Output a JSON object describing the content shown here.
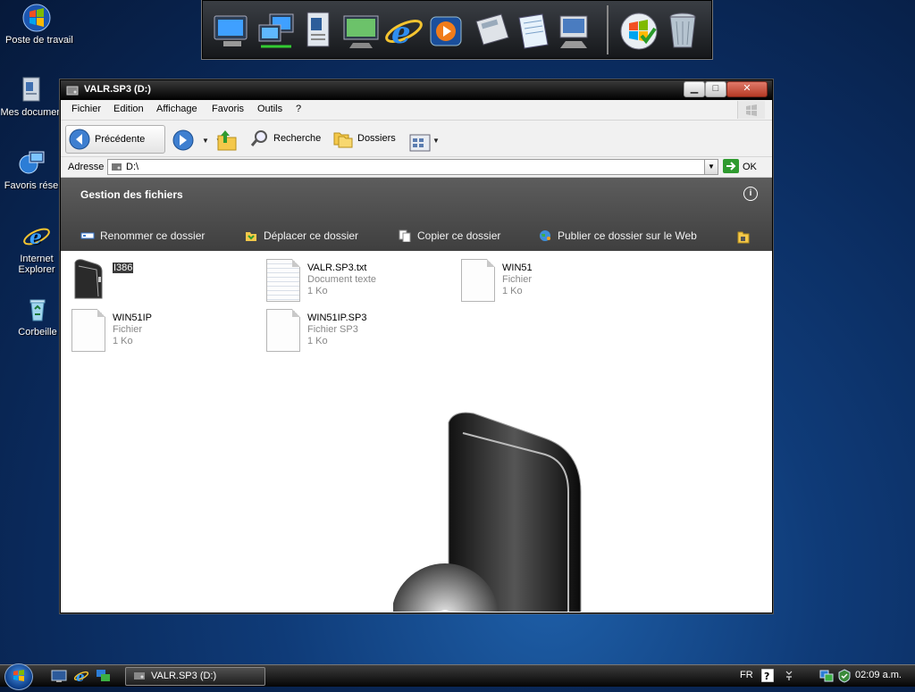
{
  "desktop": {
    "icons": [
      {
        "label": "Poste de travail",
        "icon": "computer-icon"
      },
      {
        "label": "Mes documen",
        "icon": "documents-folder-icon"
      },
      {
        "label": "Favoris rése",
        "icon": "network-icon"
      },
      {
        "label": "Internet Explorer",
        "icon": "internet-explorer-icon"
      },
      {
        "label": "Corbeille",
        "icon": "recycle-bin-icon"
      }
    ]
  },
  "dock": {
    "items": [
      "computer-icon",
      "network-icon",
      "documents-icon",
      "display-icon",
      "internet-explorer-icon",
      "media-player-icon",
      "calculator-icon",
      "notepad-icon",
      "control-panel-icon",
      "windows-update-icon",
      "recycle-bin-icon"
    ]
  },
  "window": {
    "title": "VALR.SP3 (D:)",
    "menu": [
      "Fichier",
      "Edition",
      "Affichage",
      "Favoris",
      "Outils",
      "?"
    ],
    "toolbar": {
      "back": "Précédente",
      "search": "Recherche",
      "folders": "Dossiers"
    },
    "address": {
      "label": "Adresse",
      "value": "D:\\",
      "go": "OK"
    },
    "taskpane": {
      "title": "Gestion des fichiers",
      "tasks": [
        "Renommer ce dossier",
        "Déplacer ce dossier",
        "Copier ce dossier",
        "Publier ce dossier sur le Web"
      ]
    },
    "files": [
      {
        "name": "I386",
        "type": "",
        "size": "",
        "kind": "folder",
        "selected": true
      },
      {
        "name": "VALR.SP3.txt",
        "type": "Document texte",
        "size": "1 Ko",
        "kind": "text"
      },
      {
        "name": "WIN51",
        "type": "Fichier",
        "size": "1 Ko",
        "kind": "file"
      },
      {
        "name": "WIN51IP",
        "type": "Fichier",
        "size": "1 Ko",
        "kind": "file"
      },
      {
        "name": "WIN51IP.SP3",
        "type": "Fichier SP3",
        "size": "1 Ko",
        "kind": "file"
      }
    ]
  },
  "taskbar": {
    "window_button": "VALR.SP3 (D:)",
    "language": "FR",
    "clock": "02:09 a.m."
  }
}
